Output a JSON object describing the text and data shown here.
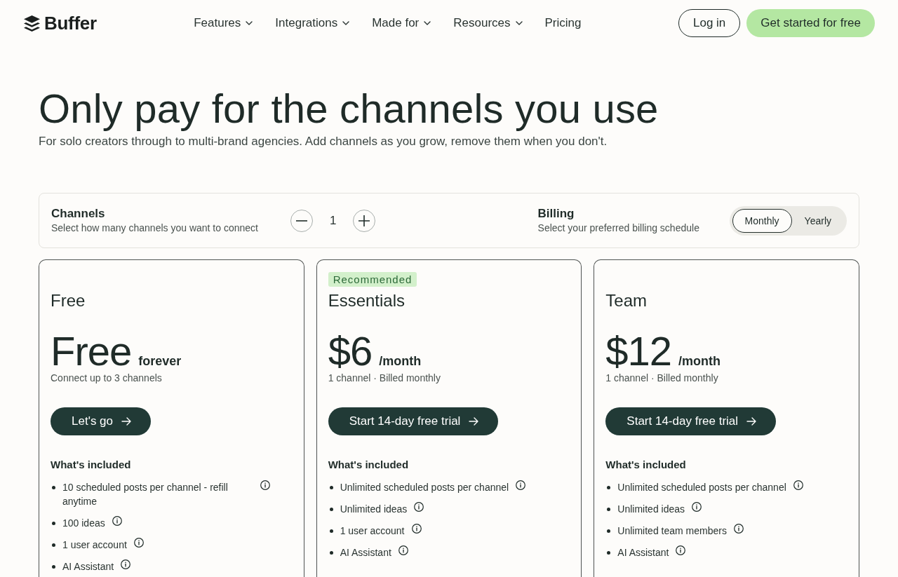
{
  "header": {
    "logo": "Buffer",
    "links": [
      {
        "label": "Features",
        "dropdown": true
      },
      {
        "label": "Integrations",
        "dropdown": true
      },
      {
        "label": "Made for",
        "dropdown": true
      },
      {
        "label": "Resources",
        "dropdown": true
      },
      {
        "label": "Pricing",
        "dropdown": false
      }
    ],
    "login_button": "Log in",
    "cta_button": "Get started for free"
  },
  "hero": {
    "title": "Only pay for the channels you use",
    "subtitle": "For solo creators through to multi-brand agencies. Add channels as you grow, remove them when you don't."
  },
  "selector": {
    "channels": {
      "label": "Channels",
      "description": "Select how many channels you want to connect",
      "count": "1"
    },
    "billing": {
      "label": "Billing",
      "description": "Select your preferred billing schedule",
      "options": [
        {
          "label": "Monthly",
          "selected": true
        },
        {
          "label": "Yearly",
          "selected": false
        }
      ]
    }
  },
  "plans": [
    {
      "name": "Free",
      "price": "Free",
      "price_suffix": "forever",
      "note": "Connect up to 3 channels",
      "button": "Let's go",
      "features_title": "What's included",
      "features": [
        {
          "text": "10 scheduled posts per channel - refill anytime",
          "info": true
        },
        {
          "text": "100 ideas",
          "info": true
        },
        {
          "text": "1 user account",
          "info": true
        },
        {
          "text": "AI Assistant",
          "info": true
        }
      ]
    },
    {
      "badge": "Recommended",
      "name": "Essentials",
      "price": "$6",
      "price_suffix": "/month",
      "note": "1 channel · Billed monthly",
      "button": "Start 14-day free trial",
      "features_title": "What's included",
      "features": [
        {
          "text": "Unlimited scheduled posts per channel",
          "info": true
        },
        {
          "text": "Unlimited ideas",
          "info": true
        },
        {
          "text": "1 user account",
          "info": true
        },
        {
          "text": "AI Assistant",
          "info": true
        }
      ]
    },
    {
      "name": "Team",
      "price": "$12",
      "price_suffix": "/month",
      "note": "1 channel · Billed monthly",
      "button": "Start 14-day free trial",
      "features_title": "What's included",
      "features": [
        {
          "text": "Unlimited scheduled posts per channel",
          "info": true
        },
        {
          "text": "Unlimited ideas",
          "info": true
        },
        {
          "text": "Unlimited team members",
          "info": true
        },
        {
          "text": "AI Assistant",
          "info": true
        }
      ]
    }
  ]
}
